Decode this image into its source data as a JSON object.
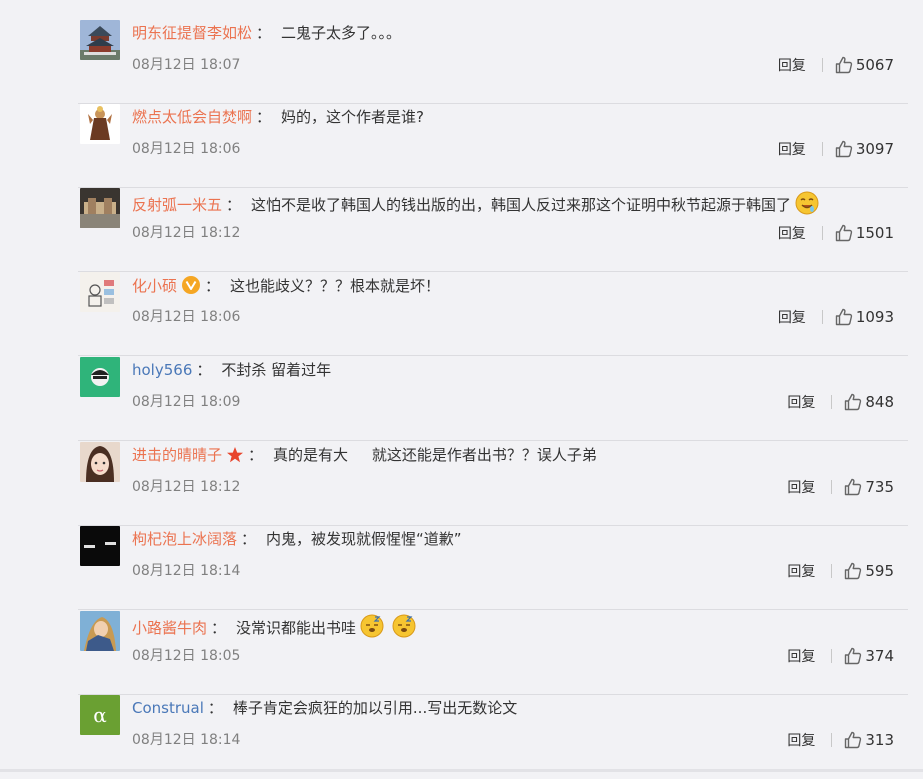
{
  "comments": [
    {
      "user": "明东征提督李如松",
      "colon": "：",
      "text": "二鬼子太多了。。。",
      "time": "08月12日 18:07",
      "reply": "回复",
      "likes": "5067",
      "badge": "",
      "emoji": 0,
      "link": "orange"
    },
    {
      "user": "燃点太低会自焚啊",
      "colon": "：",
      "text": "妈的，这个作者是谁?",
      "time": "08月12日 18:06",
      "reply": "回复",
      "likes": "3097",
      "badge": "",
      "emoji": 0,
      "link": "orange"
    },
    {
      "user": "反射弧一米五",
      "colon": "：",
      "text": "这怕不是收了韩国人的钱出版的出，韩国人反过来那这个证明中秋节起源于韩国了",
      "time": "08月12日 18:12",
      "reply": "回复",
      "likes": "1501",
      "badge": "",
      "emoji": 1,
      "link": "orange"
    },
    {
      "user": "化小硕",
      "colon": "：",
      "text": "这也能歧义？？？根本就是坏！",
      "time": "08月12日 18:06",
      "reply": "回复",
      "likes": "1093",
      "badge": "v",
      "emoji": 0,
      "link": "orange"
    },
    {
      "user": "holy566",
      "colon": "：",
      "text": "不封杀 留着过年",
      "time": "08月12日 18:09",
      "reply": "回复",
      "likes": "848",
      "badge": "",
      "emoji": 0,
      "link": "blue"
    },
    {
      "user": "进击的晴晴子",
      "colon": "：",
      "text": "真的是有大     就这还能是作者出书？？误人子弟",
      "time": "08月12日 18:12",
      "reply": "回复",
      "likes": "735",
      "badge": "star",
      "emoji": 0,
      "link": "orange"
    },
    {
      "user": "枸杞泡上冰阔落",
      "colon": "：",
      "text": "内鬼，被发现就假惺惺“道歉”",
      "time": "08月12日 18:14",
      "reply": "回复",
      "likes": "595",
      "badge": "",
      "emoji": 0,
      "link": "orange"
    },
    {
      "user": "小路酱牛肉",
      "colon": "：",
      "text": "没常识都能出书哇",
      "time": "08月12日 18:05",
      "reply": "回复",
      "likes": "374",
      "badge": "",
      "emoji": 2,
      "link": "orange"
    },
    {
      "user": "Construal",
      "colon": "：",
      "text": "棒子肯定会疯狂的加以引用...写出无数论文",
      "time": "08月12日 18:14",
      "reply": "回复",
      "likes": "313",
      "badge": "",
      "emoji": 0,
      "link": "blue"
    }
  ]
}
